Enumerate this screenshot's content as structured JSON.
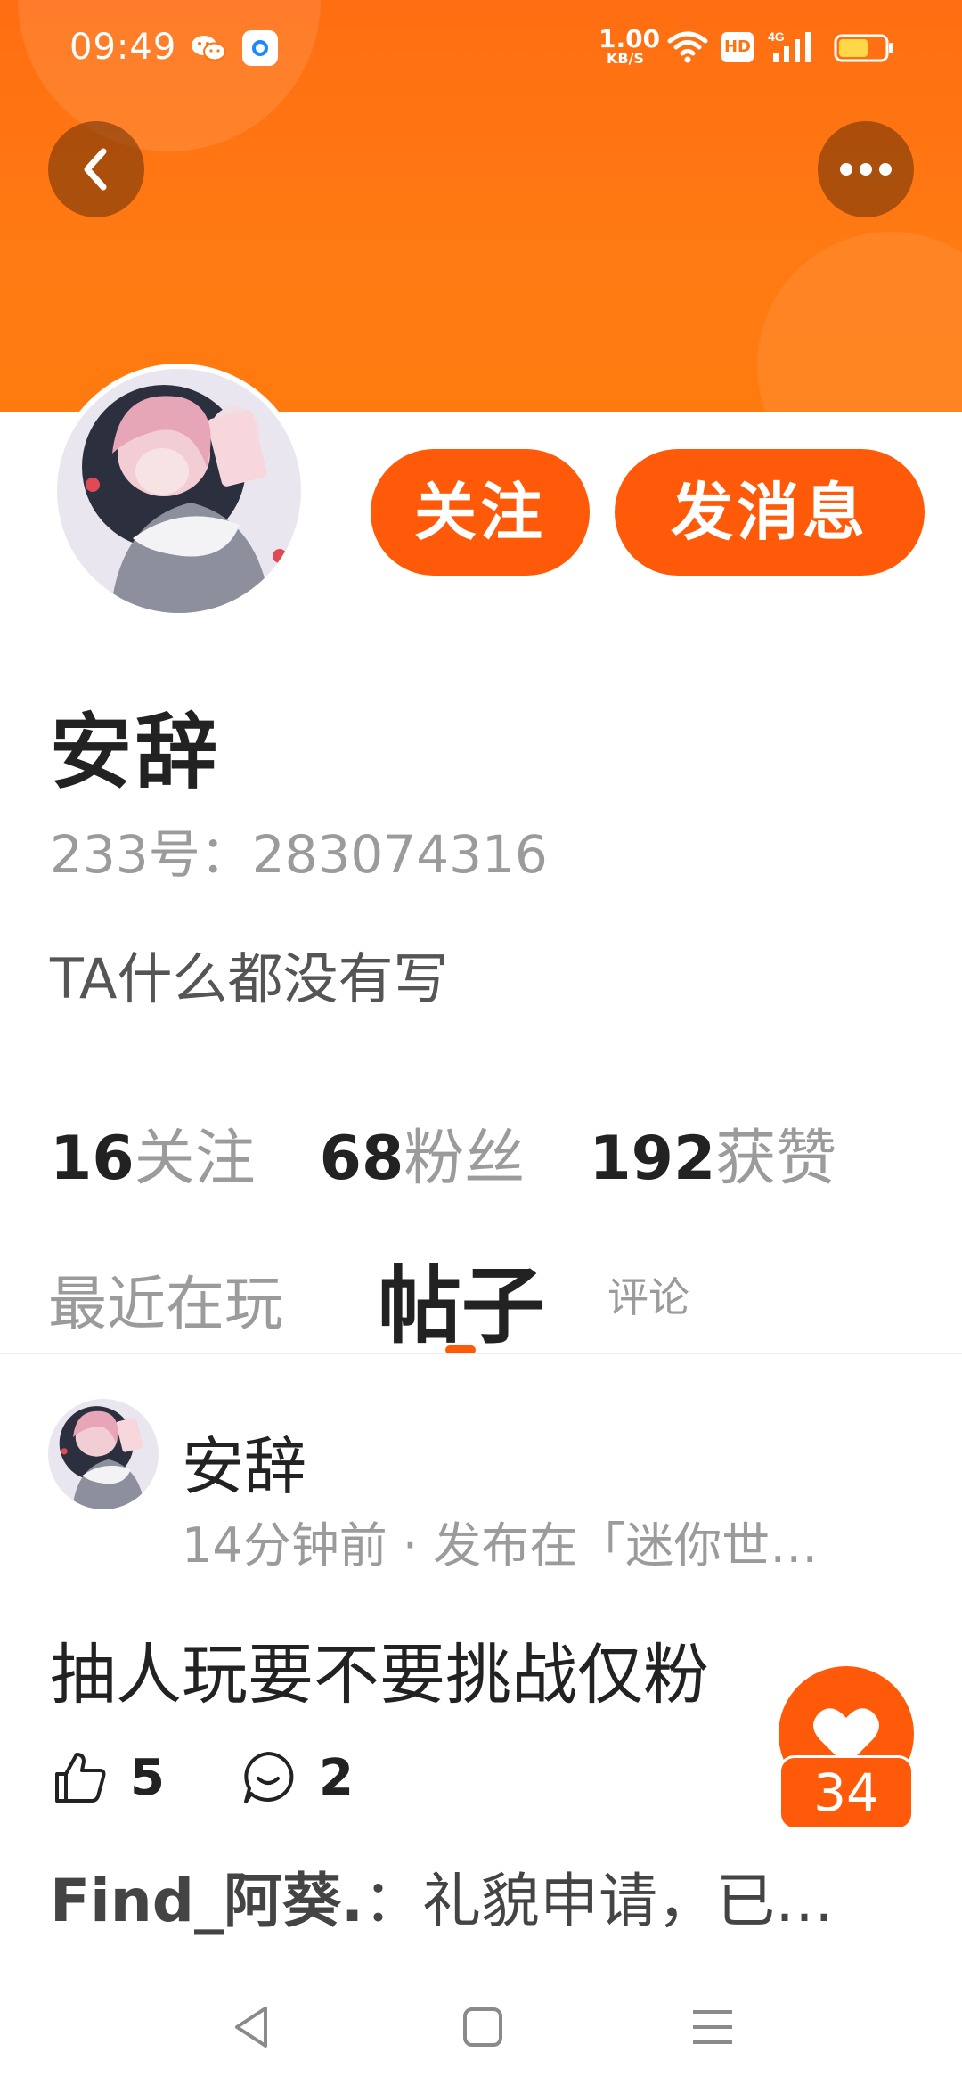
{
  "status_bar": {
    "time": "09:49",
    "speed_value": "1.00",
    "speed_unit": "KB/S",
    "hd_label": "HD",
    "network": "4G",
    "icons": [
      "wechat-icon",
      "app-icon",
      "wifi-icon",
      "signal-icon",
      "battery-icon"
    ]
  },
  "header": {
    "back_icon": "chevron-left-icon",
    "more_icon": "more-dots-icon",
    "accent_color": "#ff5a0a"
  },
  "profile": {
    "follow_label": "关注",
    "message_label": "发消息",
    "nickname": "安辞",
    "user_id": "233号：283074316",
    "bio": "TA什么都没有写",
    "stats": [
      {
        "value": "16",
        "label": "关注"
      },
      {
        "value": "68",
        "label": "粉丝"
      },
      {
        "value": "192",
        "label": "获赞"
      }
    ]
  },
  "tabs": [
    {
      "label": "最近在玩",
      "active": false
    },
    {
      "label": "帖子",
      "active": true
    },
    {
      "label": "评论",
      "active": false
    }
  ],
  "post": {
    "author": "安辞",
    "meta": "14分钟前 · 发布在「迷你世…",
    "title": "抽人玩要不要挑战仅粉",
    "likes": "5",
    "comments": "2",
    "latest_comment_author": "Find_阿葵.",
    "latest_comment_text": "：礼貌申请，已…"
  },
  "floating_like": {
    "count": "34",
    "icon": "heart-icon"
  },
  "nav": {
    "icons": [
      "nav-back-icon",
      "nav-home-icon",
      "nav-menu-icon"
    ]
  }
}
